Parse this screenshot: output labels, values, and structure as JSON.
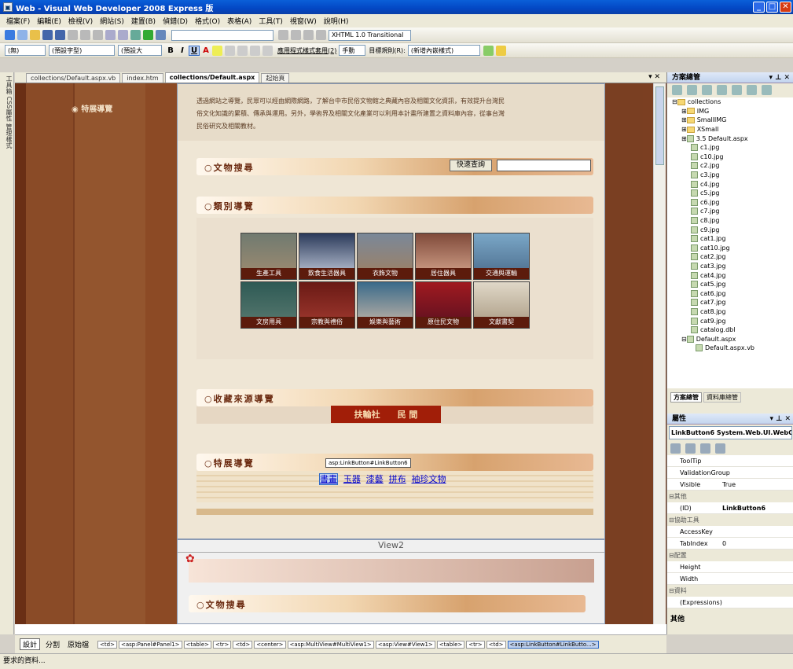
{
  "window": {
    "title": "Web - Visual Web Developer 2008 Express 版"
  },
  "menu": [
    "檔案(F)",
    "編輯(E)",
    "檢視(V)",
    "網站(S)",
    "建置(B)",
    "偵錯(D)",
    "格式(O)",
    "表格(A)",
    "工具(T)",
    "視窗(W)",
    "說明(H)"
  ],
  "toolbar2": {
    "doctype": "XHTML 1.0 Transitional"
  },
  "toolbar3": {
    "style": "(無)",
    "font": "(預設字型)",
    "size": "(預設大",
    "apply_style": "應用程式樣式套用(2)",
    "manual": "手動",
    "target_rule": "目標規則(R):",
    "new_inline": "(新增內嵌樣式)"
  },
  "left_toolbox": "工具箱 CSS屬性 管理樣式",
  "doc_tabs": [
    "collections/Default.aspx.vb",
    "index.htm",
    "collections/Default.aspx",
    "起始頁"
  ],
  "design": {
    "sidebar_item": "特展導覽",
    "intro_line1": "透過網站之導覽，民眾可以經由網際網路，了解台中市民俗文物館之典藏內容及相關文化資訊，有效提升台灣民",
    "intro_line2": "俗文化知識的累積、傳承與運用。另外，學術界及相關文化產業可以利用本計畫所建置之資料庫內容，從事台灣",
    "intro_line3": "民俗研究及相關教材。",
    "section_search": "文物搜尋",
    "quick_search": "快速查詢",
    "section_category": "類別導覽",
    "categories": [
      "生產工具",
      "飲食生活器具",
      "衣飾文物",
      "居住器具",
      "交通與運輸",
      "文房用具",
      "宗教與禮俗",
      "娛樂與藝術",
      "原住民文物",
      "文獻書契"
    ],
    "section_source": "收藏來源導覽",
    "source_links": [
      "扶輪社",
      "民 間"
    ],
    "section_exhibit": "特展導覽",
    "tooltip": "asp:LinkButton#LinkButton6",
    "exhibit_links": [
      "書畫",
      "玉器",
      "漆藝",
      "拼布",
      "袖珍文物"
    ],
    "view2_label": "View2",
    "section_search2": "文物搜尋"
  },
  "solution": {
    "title": "方案總管",
    "root": "collections",
    "items": [
      "IMG",
      "SmallIMG",
      "XSmall",
      "3.5 Default.aspx",
      "c1.jpg",
      "c10.jpg",
      "c2.jpg",
      "c3.jpg",
      "c4.jpg",
      "c5.jpg",
      "c6.jpg",
      "c7.jpg",
      "c8.jpg",
      "c9.jpg",
      "cat1.jpg",
      "cat10.jpg",
      "cat2.jpg",
      "cat3.jpg",
      "cat4.jpg",
      "cat5.jpg",
      "cat6.jpg",
      "cat7.jpg",
      "cat8.jpg",
      "cat9.jpg",
      "catalog.dbl",
      "Default.aspx",
      "Default.aspx.vb"
    ],
    "tab1": "方案總管",
    "tab2": "資料庫總管"
  },
  "properties": {
    "title": "屬性",
    "object": "LinkButton6 System.Web.UI.WebC",
    "rows": [
      {
        "k": "ToolTip",
        "v": ""
      },
      {
        "k": "ValidationGroup",
        "v": ""
      },
      {
        "k": "Visible",
        "v": "True"
      }
    ],
    "cat_other": "其他",
    "id_key": "(ID)",
    "id_val": "LinkButton6",
    "cat_access": "協助工具",
    "access_rows": [
      {
        "k": "AccessKey",
        "v": ""
      },
      {
        "k": "TabIndex",
        "v": "0"
      }
    ],
    "cat_layout": "配置",
    "layout_rows": [
      {
        "k": "Height",
        "v": ""
      },
      {
        "k": "Width",
        "v": ""
      }
    ],
    "cat_data": "資料",
    "data_rows": [
      {
        "k": "(Expressions)",
        "v": ""
      }
    ],
    "footer": "其他"
  },
  "bottom": {
    "design": "設計",
    "split": "分割",
    "source": "原始檔",
    "tags": [
      "<td>",
      "<asp:Panel#Panel1>",
      "<table>",
      "<tr>",
      "<td>",
      "<center>",
      "<asp:MultiView#MultiView1>",
      "<asp:View#View1>",
      "<table>",
      "<tr>",
      "<td>",
      "<asp:LinkButton#LinkButto...>"
    ]
  },
  "status": "要求的資料..."
}
